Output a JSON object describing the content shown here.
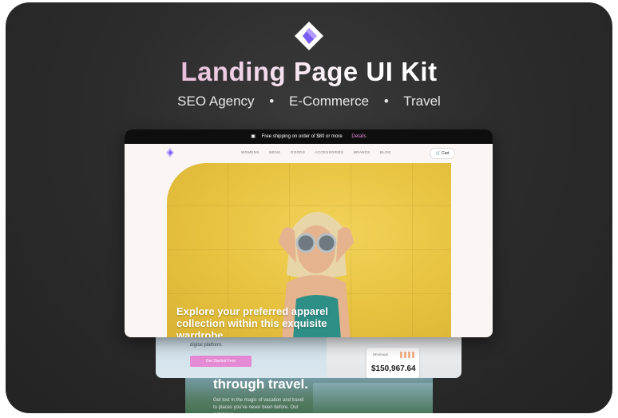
{
  "header": {
    "title": "Landing Page UI Kit",
    "tags": [
      "SEO Agency",
      "E-Commerce",
      "Travel"
    ],
    "separator": "•"
  },
  "colors": {
    "accent": "#e58ad4",
    "brand_purple": "#7b5cf0",
    "frame_bg": "#2b2b2b"
  },
  "mockup": {
    "promo": {
      "icon": "truck-icon",
      "text": "Free shipping on order of $80 or more",
      "link": "Details"
    },
    "nav": {
      "links": [
        "WOMENS",
        "MENS",
        "GOODS",
        "ACCESSORIES",
        "BRANDS",
        "BLOG"
      ],
      "cart_icon": "cart-icon",
      "cart_label": "Cart"
    },
    "hero": {
      "headline": "Explore your preferred apparel collection within this exquisite wardrobe"
    },
    "seo_section": {
      "text": "digital platform.",
      "cta": "Get Started Free",
      "card_label": "REVENUE",
      "card_value": "$150,967.64"
    },
    "travel_section": {
      "heading": "through travel.",
      "body": "Get lost in the magic of vacation and travel to places you've never been before. Our extensive"
    }
  }
}
